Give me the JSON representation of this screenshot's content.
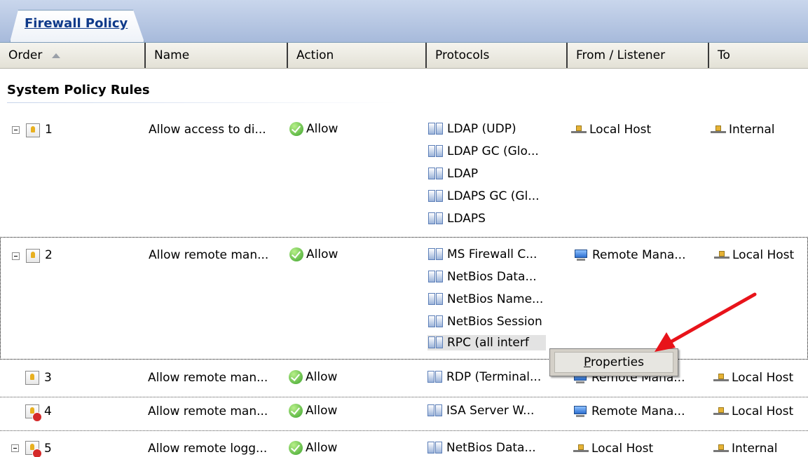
{
  "tab": {
    "label": "Firewall Policy"
  },
  "columns": [
    "Order",
    "Name",
    "Action",
    "Protocols",
    "From / Listener",
    "To"
  ],
  "section": {
    "title": "System Policy Rules"
  },
  "rules": [
    {
      "order": "1",
      "name": "Allow access to di...",
      "action": "Allow",
      "protocols": [
        "LDAP (UDP)",
        "LDAP GC (Glo...",
        "LDAP",
        "LDAPS GC (Gl...",
        "LDAPS"
      ],
      "from": "Local Host",
      "to": "Internal"
    },
    {
      "order": "2",
      "name": "Allow remote man...",
      "action": "Allow",
      "protocols": [
        "MS Firewall C...",
        "NetBios Data...",
        "NetBios Name...",
        "NetBios Session",
        "RPC (all interf"
      ],
      "from": "Remote Mana...",
      "to": "Local Host"
    },
    {
      "order": "3",
      "name": "Allow remote man...",
      "action": "Allow",
      "protocols": [
        "RDP (Terminal..."
      ],
      "from": "Remote Mana...",
      "to": "Local Host"
    },
    {
      "order": "4",
      "name": "Allow remote man...",
      "action": "Allow",
      "protocols": [
        "ISA Server W..."
      ],
      "from": "Remote Mana...",
      "to": "Local Host"
    },
    {
      "order": "5",
      "name": "Allow remote logg...",
      "action": "Allow",
      "protocols": [
        "NetBios Data..."
      ],
      "from": "Local Host",
      "to": "Internal"
    }
  ],
  "context_menu": {
    "item_prefix": "P",
    "item_rest": "roperties"
  },
  "colors": {
    "arrow": "#e8131a",
    "tab_text": "#0f3a8a"
  }
}
